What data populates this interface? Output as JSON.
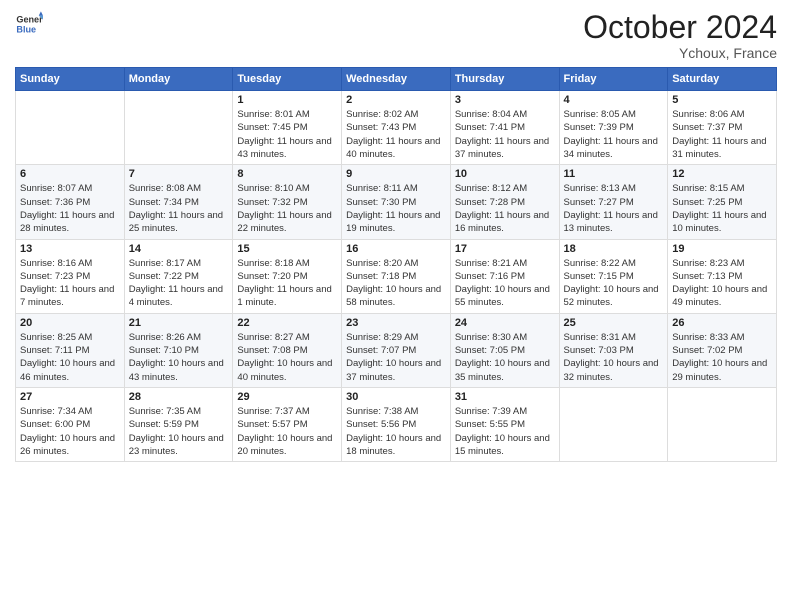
{
  "header": {
    "logo_general": "General",
    "logo_blue": "Blue",
    "month_title": "October 2024",
    "location": "Ychoux, France"
  },
  "weekdays": [
    "Sunday",
    "Monday",
    "Tuesday",
    "Wednesday",
    "Thursday",
    "Friday",
    "Saturday"
  ],
  "weeks": [
    [
      {
        "day": "",
        "sunrise": "",
        "sunset": "",
        "daylight": ""
      },
      {
        "day": "",
        "sunrise": "",
        "sunset": "",
        "daylight": ""
      },
      {
        "day": "1",
        "sunrise": "Sunrise: 8:01 AM",
        "sunset": "Sunset: 7:45 PM",
        "daylight": "Daylight: 11 hours and 43 minutes."
      },
      {
        "day": "2",
        "sunrise": "Sunrise: 8:02 AM",
        "sunset": "Sunset: 7:43 PM",
        "daylight": "Daylight: 11 hours and 40 minutes."
      },
      {
        "day": "3",
        "sunrise": "Sunrise: 8:04 AM",
        "sunset": "Sunset: 7:41 PM",
        "daylight": "Daylight: 11 hours and 37 minutes."
      },
      {
        "day": "4",
        "sunrise": "Sunrise: 8:05 AM",
        "sunset": "Sunset: 7:39 PM",
        "daylight": "Daylight: 11 hours and 34 minutes."
      },
      {
        "day": "5",
        "sunrise": "Sunrise: 8:06 AM",
        "sunset": "Sunset: 7:37 PM",
        "daylight": "Daylight: 11 hours and 31 minutes."
      }
    ],
    [
      {
        "day": "6",
        "sunrise": "Sunrise: 8:07 AM",
        "sunset": "Sunset: 7:36 PM",
        "daylight": "Daylight: 11 hours and 28 minutes."
      },
      {
        "day": "7",
        "sunrise": "Sunrise: 8:08 AM",
        "sunset": "Sunset: 7:34 PM",
        "daylight": "Daylight: 11 hours and 25 minutes."
      },
      {
        "day": "8",
        "sunrise": "Sunrise: 8:10 AM",
        "sunset": "Sunset: 7:32 PM",
        "daylight": "Daylight: 11 hours and 22 minutes."
      },
      {
        "day": "9",
        "sunrise": "Sunrise: 8:11 AM",
        "sunset": "Sunset: 7:30 PM",
        "daylight": "Daylight: 11 hours and 19 minutes."
      },
      {
        "day": "10",
        "sunrise": "Sunrise: 8:12 AM",
        "sunset": "Sunset: 7:28 PM",
        "daylight": "Daylight: 11 hours and 16 minutes."
      },
      {
        "day": "11",
        "sunrise": "Sunrise: 8:13 AM",
        "sunset": "Sunset: 7:27 PM",
        "daylight": "Daylight: 11 hours and 13 minutes."
      },
      {
        "day": "12",
        "sunrise": "Sunrise: 8:15 AM",
        "sunset": "Sunset: 7:25 PM",
        "daylight": "Daylight: 11 hours and 10 minutes."
      }
    ],
    [
      {
        "day": "13",
        "sunrise": "Sunrise: 8:16 AM",
        "sunset": "Sunset: 7:23 PM",
        "daylight": "Daylight: 11 hours and 7 minutes."
      },
      {
        "day": "14",
        "sunrise": "Sunrise: 8:17 AM",
        "sunset": "Sunset: 7:22 PM",
        "daylight": "Daylight: 11 hours and 4 minutes."
      },
      {
        "day": "15",
        "sunrise": "Sunrise: 8:18 AM",
        "sunset": "Sunset: 7:20 PM",
        "daylight": "Daylight: 11 hours and 1 minute."
      },
      {
        "day": "16",
        "sunrise": "Sunrise: 8:20 AM",
        "sunset": "Sunset: 7:18 PM",
        "daylight": "Daylight: 10 hours and 58 minutes."
      },
      {
        "day": "17",
        "sunrise": "Sunrise: 8:21 AM",
        "sunset": "Sunset: 7:16 PM",
        "daylight": "Daylight: 10 hours and 55 minutes."
      },
      {
        "day": "18",
        "sunrise": "Sunrise: 8:22 AM",
        "sunset": "Sunset: 7:15 PM",
        "daylight": "Daylight: 10 hours and 52 minutes."
      },
      {
        "day": "19",
        "sunrise": "Sunrise: 8:23 AM",
        "sunset": "Sunset: 7:13 PM",
        "daylight": "Daylight: 10 hours and 49 minutes."
      }
    ],
    [
      {
        "day": "20",
        "sunrise": "Sunrise: 8:25 AM",
        "sunset": "Sunset: 7:11 PM",
        "daylight": "Daylight: 10 hours and 46 minutes."
      },
      {
        "day": "21",
        "sunrise": "Sunrise: 8:26 AM",
        "sunset": "Sunset: 7:10 PM",
        "daylight": "Daylight: 10 hours and 43 minutes."
      },
      {
        "day": "22",
        "sunrise": "Sunrise: 8:27 AM",
        "sunset": "Sunset: 7:08 PM",
        "daylight": "Daylight: 10 hours and 40 minutes."
      },
      {
        "day": "23",
        "sunrise": "Sunrise: 8:29 AM",
        "sunset": "Sunset: 7:07 PM",
        "daylight": "Daylight: 10 hours and 37 minutes."
      },
      {
        "day": "24",
        "sunrise": "Sunrise: 8:30 AM",
        "sunset": "Sunset: 7:05 PM",
        "daylight": "Daylight: 10 hours and 35 minutes."
      },
      {
        "day": "25",
        "sunrise": "Sunrise: 8:31 AM",
        "sunset": "Sunset: 7:03 PM",
        "daylight": "Daylight: 10 hours and 32 minutes."
      },
      {
        "day": "26",
        "sunrise": "Sunrise: 8:33 AM",
        "sunset": "Sunset: 7:02 PM",
        "daylight": "Daylight: 10 hours and 29 minutes."
      }
    ],
    [
      {
        "day": "27",
        "sunrise": "Sunrise: 7:34 AM",
        "sunset": "Sunset: 6:00 PM",
        "daylight": "Daylight: 10 hours and 26 minutes."
      },
      {
        "day": "28",
        "sunrise": "Sunrise: 7:35 AM",
        "sunset": "Sunset: 5:59 PM",
        "daylight": "Daylight: 10 hours and 23 minutes."
      },
      {
        "day": "29",
        "sunrise": "Sunrise: 7:37 AM",
        "sunset": "Sunset: 5:57 PM",
        "daylight": "Daylight: 10 hours and 20 minutes."
      },
      {
        "day": "30",
        "sunrise": "Sunrise: 7:38 AM",
        "sunset": "Sunset: 5:56 PM",
        "daylight": "Daylight: 10 hours and 18 minutes."
      },
      {
        "day": "31",
        "sunrise": "Sunrise: 7:39 AM",
        "sunset": "Sunset: 5:55 PM",
        "daylight": "Daylight: 10 hours and 15 minutes."
      },
      {
        "day": "",
        "sunrise": "",
        "sunset": "",
        "daylight": ""
      },
      {
        "day": "",
        "sunrise": "",
        "sunset": "",
        "daylight": ""
      }
    ]
  ]
}
